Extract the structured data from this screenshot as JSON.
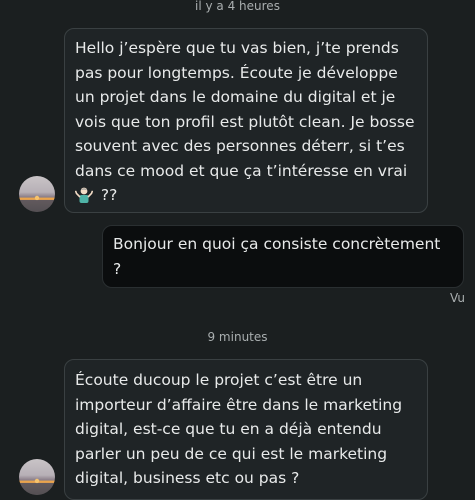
{
  "timestamps": {
    "first": "il y a 4 heures",
    "second": "9 minutes"
  },
  "messages": [
    {
      "direction": "incoming",
      "text": "Hello j’espère que tu vas bien, j’te prends pas pour longtemps. Écoute je développe un projet dans le domaine du digital et je vois que ton profil est plutôt clean. Je bosse souvent avec des personnes déterr, si t’es dans ce mood et que ça t’intéresse en vrai",
      "emoji": "person-shrugging",
      "suffix": "??"
    },
    {
      "direction": "outgoing",
      "text": "Bonjour en quoi ça consiste concrètement ?"
    },
    {
      "direction": "incoming",
      "text": "Écoute ducoup le projet c’est être un importeur d’affaire être dans le marketing digital, est-ce que tu en a déjà entendu parler un peu de ce qui est le marketing digital, business etc ou pas ?"
    }
  ],
  "status": {
    "seen_label": "Vu"
  },
  "colors": {
    "background": "#1b1f20",
    "incoming_bubble": "#1f2426",
    "outgoing_bubble": "#0b0d0e",
    "text": "#e8eaea",
    "muted": "#a9aeaf"
  }
}
